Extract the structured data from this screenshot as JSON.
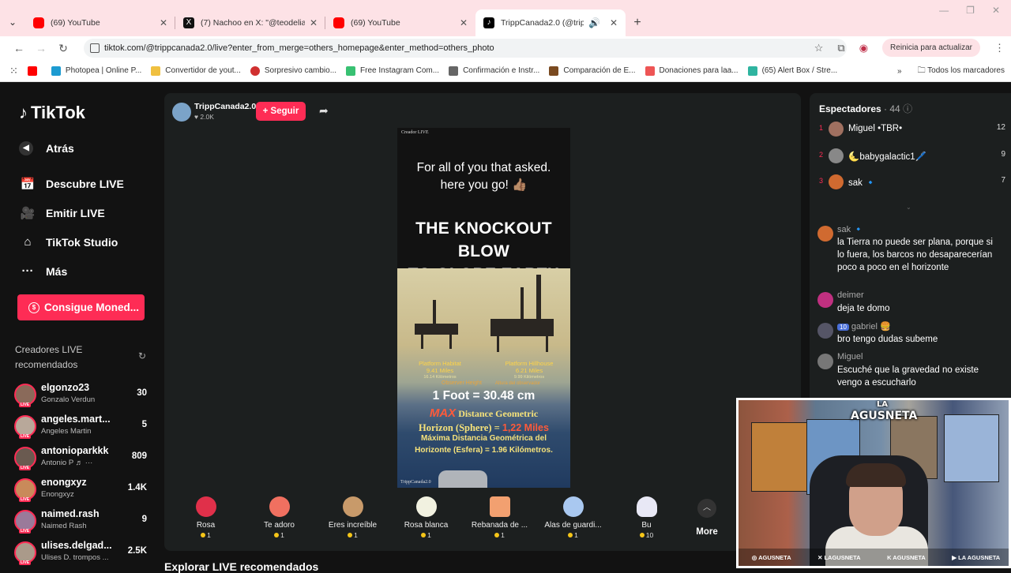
{
  "browser": {
    "tabs": [
      {
        "title": "(69) YouTube",
        "icon": "youtube-favicon",
        "active": false
      },
      {
        "title": "(7) Nachoo en X: \"@teodeliaa",
        "icon": "x-favicon",
        "active": false
      },
      {
        "title": "(69) YouTube",
        "icon": "youtube-favicon",
        "active": false
      },
      {
        "title": "TrippCanada2.0 (@trippcan",
        "icon": "tiktok-favicon",
        "active": true
      }
    ],
    "url": "tiktok.com/@trippcanada2.0/live?enter_from_merge=others_homepage&enter_method=others_photo",
    "update_label": "Reinicia para actualizar",
    "bookmarks": [
      {
        "label": "",
        "color": "#ff0000"
      },
      {
        "label": "Photopea | Online P...",
        "color": "#1d9bd1"
      },
      {
        "label": "Convertidor de yout...",
        "color": "#f0c040"
      },
      {
        "label": "Sorpresivo cambio...",
        "color": "#d03030"
      },
      {
        "label": "Free Instagram Com...",
        "color": "#38c172"
      },
      {
        "label": "Confirmación e Instr...",
        "color": "#666666"
      },
      {
        "label": "Comparación de E...",
        "color": "#7a4a20"
      },
      {
        "label": "Donaciones para laa...",
        "color": "#e55"
      },
      {
        "label": "(65) Alert Box / Stre...",
        "color": "#2fb4a0"
      }
    ],
    "all_bookmarks_label": "Todos los marcadores"
  },
  "tiktok": {
    "logo": "TikTok",
    "nav": {
      "back": "Atrás",
      "discover": "Descubre LIVE",
      "broadcast": "Emitir LIVE",
      "studio": "TikTok Studio",
      "more": "Más"
    },
    "coins_button": "Consigue Moned...",
    "recommended_title": "Creadores LIVE recomendados",
    "creators": [
      {
        "name": "elgonzo23",
        "sub": "Gonzalo Verdun",
        "count": "30"
      },
      {
        "name": "angeles.mart...",
        "sub": "Angeles Martin",
        "count": "5"
      },
      {
        "name": "antonioparkkk",
        "sub": "Antonio P ♬ ···",
        "count": "809"
      },
      {
        "name": "enongxyz",
        "sub": "Enongxyz",
        "count": "1.4K"
      },
      {
        "name": "naimed.rash",
        "sub": "Naimed Rash",
        "count": "9"
      },
      {
        "name": "ulises.delgad...",
        "sub": "Ulises D. trompos ...",
        "count": "2.5K"
      }
    ],
    "live": {
      "host_name": "TrippCanada2.0",
      "host_likes": "♥ 2.0K",
      "follow_label": "+ Seguir"
    },
    "video": {
      "tag": "Creador LIVE",
      "asked_line1": "For all of you that asked.",
      "asked_line2": "here you go! 👍🏽",
      "headline_line1": "THE KNOCKOUT BLOW",
      "headline_line2": "TO GLOBE EARTH",
      "platform_left": "Platform Habitat",
      "platform_left_dist": "9.41 Miles",
      "platform_left_km": "16.14 Kilómetros",
      "platform_right": "Platform Hillhouse",
      "platform_right_dist": "6.21 Miles",
      "platform_right_km": "9.99 Kilómetros",
      "observer_en": "Observer Height",
      "observer_es": "Altura del observador",
      "foot": "1 Foot = 30.48 cm",
      "max_word": "MAX",
      "max_rest": "Distance Geometric",
      "horizon_prefix": "Horizon (Sphere) = ",
      "horizon_value": "1,22 Miles",
      "es_line1": "Máxima Distancia Geométrica del",
      "es_line2": "Horizonte (Esfera) = 1.96 Kilómetros.",
      "credit": "TrippCanada2.0"
    },
    "gifts": [
      {
        "name": "Rosa",
        "price": "1",
        "color": "#e0304a"
      },
      {
        "name": "Te adoro",
        "price": "1",
        "color": "#f07060"
      },
      {
        "name": "Eres increíble",
        "price": "1",
        "color": "#c89a6a"
      },
      {
        "name": "Rosa blanca",
        "price": "1",
        "color": "#f1f1e0"
      },
      {
        "name": "Rebanada de ...",
        "price": "1",
        "color": "#f2a070"
      },
      {
        "name": "Alas de guardi...",
        "price": "1",
        "color": "#a9c8f0"
      },
      {
        "name": "Bu",
        "price": "10",
        "color": "#e8e8f5"
      }
    ],
    "more_label": "More",
    "bottom_heading": "Explorar LIVE recomendados"
  },
  "chat": {
    "viewers_label": "Espectadores",
    "viewers_count": "· 44",
    "top_viewers": [
      {
        "rank": "1",
        "name": "Miguel •TBR•",
        "score": "12"
      },
      {
        "rank": "2",
        "name": "🌜babygalactic1🖊️",
        "score": "9"
      },
      {
        "rank": "3",
        "name": "sak 🔹",
        "score": "7"
      }
    ],
    "messages": [
      {
        "user": "sak 🔹",
        "text": "la Tierra no puede ser plana, porque si lo fuera, los barcos no desaparecerían poco a poco en el horizonte"
      },
      {
        "user": "deimer",
        "text": "deja te domo"
      },
      {
        "user": "gabriel 🍔",
        "badge": "10",
        "text": "bro tengo dudas subeme"
      },
      {
        "user": "Miguel",
        "text": "Escuché que la gravedad no existe vengo a escucharlo"
      }
    ]
  },
  "webcam": {
    "overlay_logo_top": "LA",
    "overlay_logo_name": "AGUSNETA",
    "socials": [
      "AGUSNETA",
      "LAGUSNETA",
      "AGUSNETA",
      "LA AGUSNETA"
    ]
  }
}
